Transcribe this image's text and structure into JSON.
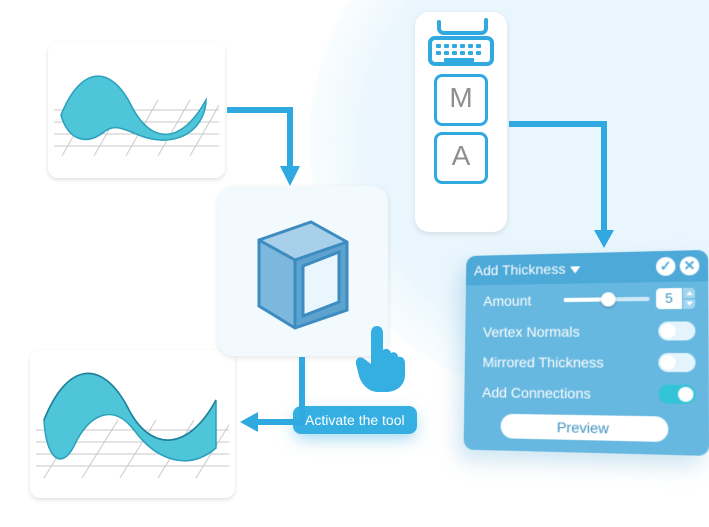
{
  "keyboard": {
    "key1": "M",
    "key2": "A"
  },
  "cube": {
    "tooltip": "Activate the tool"
  },
  "panel": {
    "title": "Add Thickness",
    "amount": {
      "label": "Amount",
      "value": "5"
    },
    "options": {
      "vertex_normals": {
        "label": "Vertex Normals",
        "on": false
      },
      "mirrored": {
        "label": "Mirrored Thickness",
        "on": false
      },
      "add_connections": {
        "label": "Add Connections",
        "on": true
      }
    },
    "preview_label": "Preview"
  }
}
